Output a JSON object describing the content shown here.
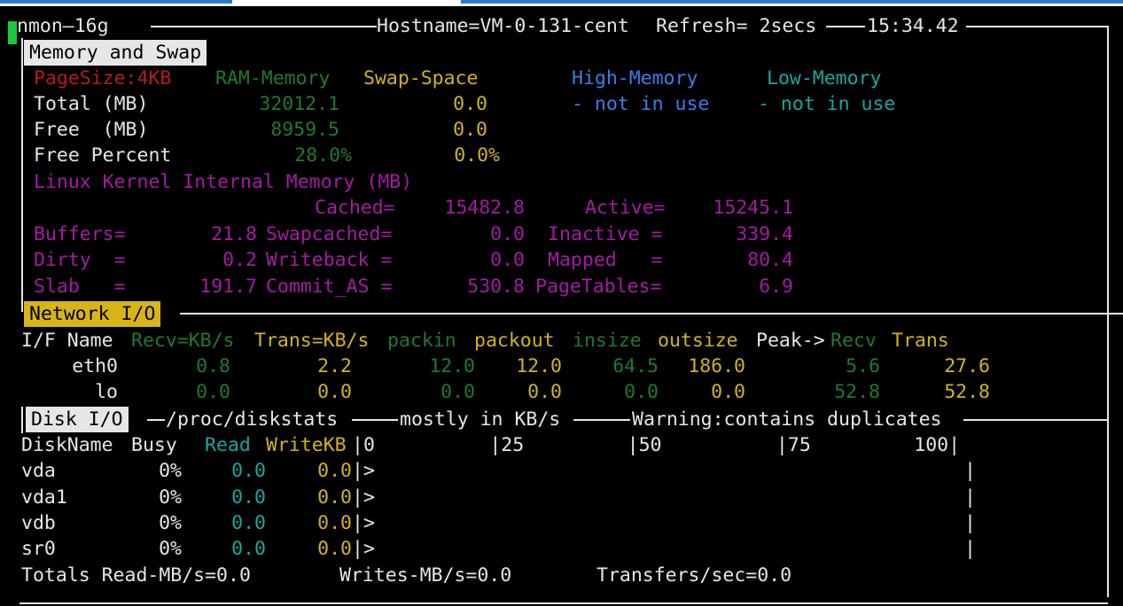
{
  "header": {
    "app": "nmon—16g",
    "hostname": "Hostname=VM-0-131-cent",
    "refresh": "Refresh= 2secs",
    "clock": "15:34.42"
  },
  "memory": {
    "section_label": "Memory and Swap",
    "pagesize": "PageSize:4KB",
    "col_ram": "RAM-Memory",
    "col_swap": "Swap-Space",
    "col_high": "High-Memory",
    "col_low": "Low-Memory",
    "rows": [
      {
        "label": "Total (MB)",
        "ram": "32012.1",
        "swap": "0.0",
        "high": "- not in use",
        "low": "- not in use"
      },
      {
        "label": "Free  (MB)",
        "ram": "8959.5",
        "swap": "0.0",
        "high": "",
        "low": ""
      },
      {
        "label": "Free Percent",
        "ram": "28.0%",
        "swap": "0.0%",
        "high": "",
        "low": ""
      }
    ],
    "kernel_title": "Linux Kernel Internal Memory (MB)",
    "kernel": [
      {
        "l1": "",
        "v1": "",
        "l2": "Cached=",
        "v2": "15482.8",
        "l3": "Active=",
        "v3": "15245.1"
      },
      {
        "l1": "Buffers=",
        "v1": "21.8",
        "l2": "Swapcached=",
        "v2": "0.0",
        "l3": "Inactive =",
        "v3": "339.4"
      },
      {
        "l1": "Dirty  =",
        "v1": "0.2",
        "l2": "Writeback =",
        "v2": "0.0",
        "l3": "Mapped   =",
        "v3": "80.4"
      },
      {
        "l1": "Slab   =",
        "v1": "191.7",
        "l2": "Commit_AS =",
        "v2": "530.8",
        "l3": "PageTables=",
        "v3": "6.9"
      }
    ]
  },
  "network": {
    "section_label": "Network I/O",
    "headers": {
      "ifname": "I/F Name",
      "recv": "Recv=KB/s",
      "trans": "Trans=KB/s",
      "packin": "packin",
      "packout": "packout",
      "insize": "insize",
      "outsize": "outsize",
      "peak": "Peak->",
      "peak_recv": "Recv",
      "peak_trans": "Trans"
    },
    "rows": [
      {
        "name": "eth0",
        "recv": "0.8",
        "trans": "2.2",
        "packin": "12.0",
        "packout": "12.0",
        "insize": "64.5",
        "outsize": "186.0",
        "peak_recv": "5.6",
        "peak_trans": "27.6"
      },
      {
        "name": "lo",
        "recv": "0.0",
        "trans": "0.0",
        "packin": "0.0",
        "packout": "0.0",
        "insize": "0.0",
        "outsize": "0.0",
        "peak_recv": "52.8",
        "peak_trans": "52.8"
      }
    ]
  },
  "disk": {
    "section_label": "Disk I/O",
    "banner_a": "/proc/diskstats",
    "banner_b": "mostly in KB/s",
    "banner_c": "Warning:contains duplicates",
    "headers": {
      "name": "DiskName",
      "busy": "Busy",
      "read": "Read",
      "write": "WriteKB",
      "scale": "|0          |25         |50          |75         100|"
    },
    "rows": [
      {
        "name": "vda",
        "busy": "0%",
        "read": "0.0",
        "write": "0.0",
        "bar": "|>"
      },
      {
        "name": "vda1",
        "busy": "0%",
        "read": "0.0",
        "write": "0.0",
        "bar": "|>"
      },
      {
        "name": "vdb",
        "busy": "0%",
        "read": "0.0",
        "write": "0.0",
        "bar": "|>"
      },
      {
        "name": "sr0",
        "busy": "0%",
        "read": "0.0",
        "write": "0.0",
        "bar": "|>"
      }
    ],
    "totals_read": "Totals Read-MB/s=0.0",
    "totals_writes": "Writes-MB/s=0.0",
    "totals_transfers": "Transfers/sec=0.0"
  }
}
